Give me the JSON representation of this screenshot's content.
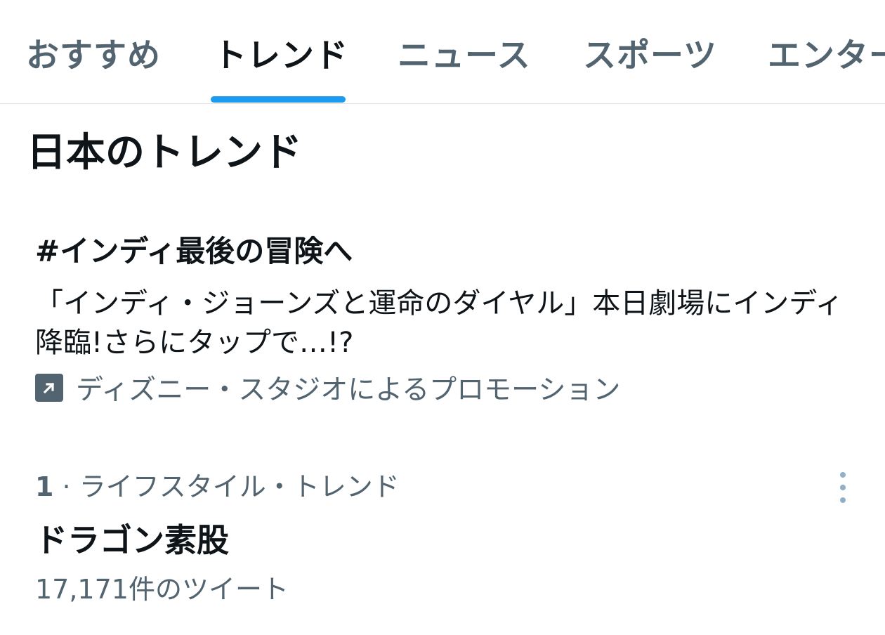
{
  "tabs": [
    {
      "label": "おすすめ",
      "active": false
    },
    {
      "label": "トレンド",
      "active": true
    },
    {
      "label": "ニュース",
      "active": false
    },
    {
      "label": "スポーツ",
      "active": false
    },
    {
      "label": "エンター",
      "active": false
    }
  ],
  "section_title": "日本のトレンド",
  "promoted": {
    "title": "#インディ最後の冒険へ",
    "description": "「インディ・ジョーンズと運命のダイヤル」本日劇場にインディ降臨!さらにタップで…!?",
    "promoted_by": "ディズニー・スタジオによるプロモーション",
    "icon": "promoted-arrow-icon"
  },
  "trends": [
    {
      "rank": "1",
      "category": "ライフスタイル・トレンド",
      "separator": "·",
      "name": "ドラゴン素股",
      "tweet_count": "17,171件のツイート"
    }
  ],
  "colors": {
    "accent": "#1d9bf0",
    "text_primary": "#0f1419",
    "text_secondary": "#536471",
    "divider": "#dfe3e6"
  }
}
